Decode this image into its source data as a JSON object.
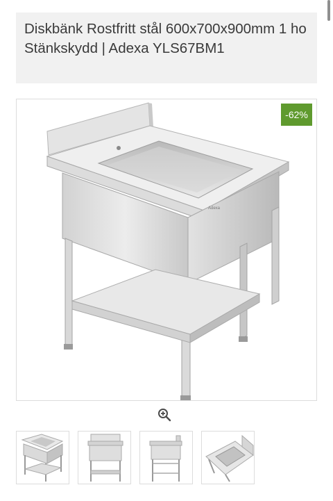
{
  "product": {
    "title": "Diskbänk Rostfritt stål 600x700x900mm 1 ho Stänkskydd | Adexa YLS67BM1",
    "image_alt": "Diskbänk Rostfritt stål 600x700x900mm 1 ho Stänkskydd",
    "discount_badge": "-62%"
  },
  "colors": {
    "badge_bg": "#5f9a2e",
    "title_bg": "#f1f1f1",
    "steel_light": "#e6e6e6",
    "steel_mid": "#cfcfcf",
    "steel_dark": "#a9a9a9"
  },
  "gallery": {
    "zoom_icon": "zoom-in-icon",
    "thumbnails": [
      {
        "view": "front-angle"
      },
      {
        "view": "front"
      },
      {
        "view": "side"
      },
      {
        "view": "top"
      }
    ]
  }
}
